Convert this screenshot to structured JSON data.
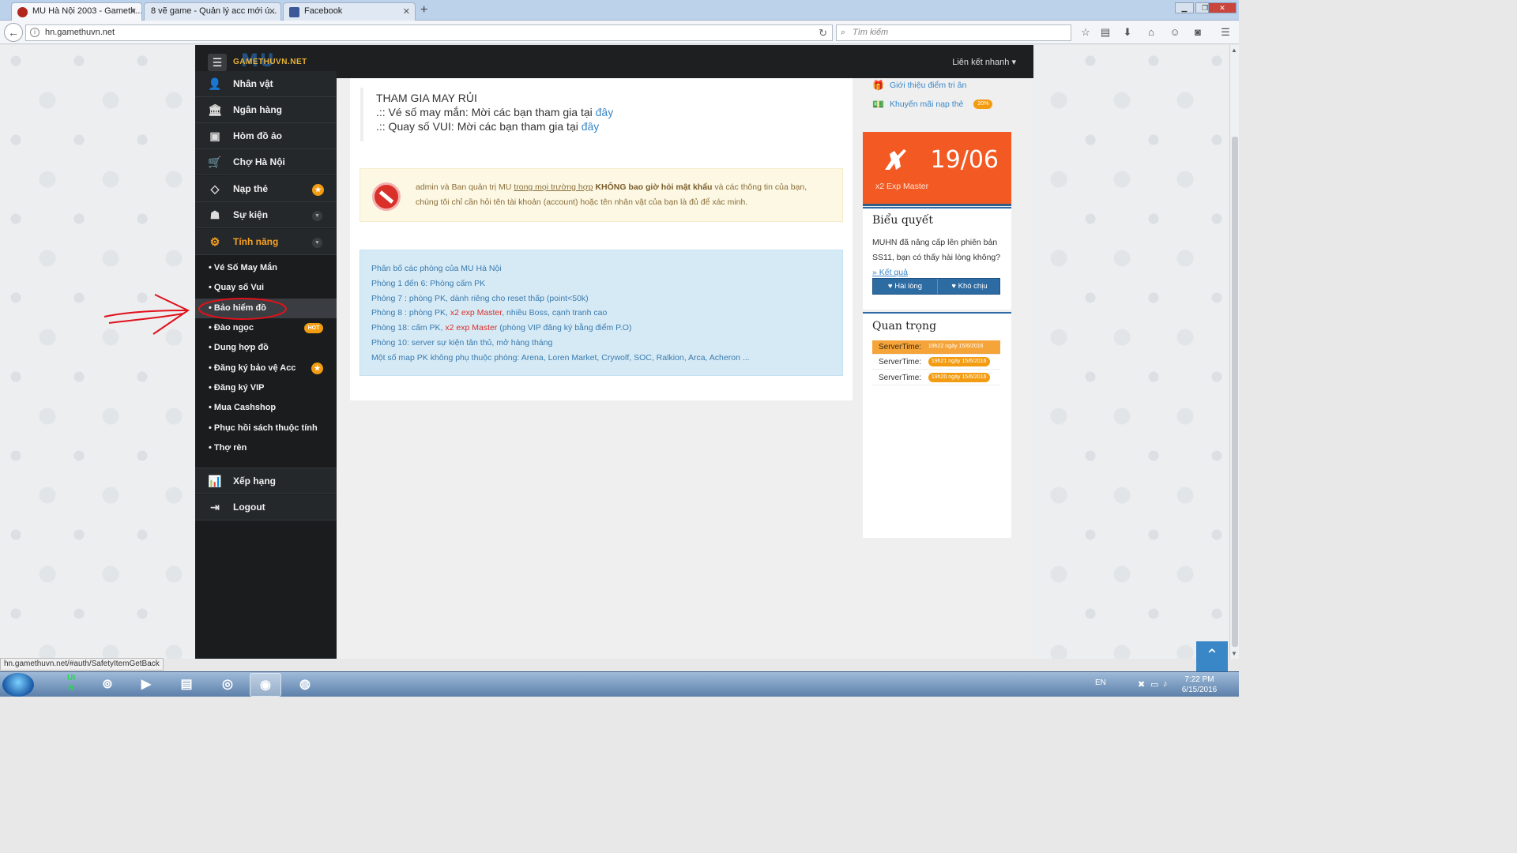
{
  "browser": {
    "tabs": [
      {
        "label": "MU Hà Nội 2003 - Gameth...",
        "active": true
      },
      {
        "label": "8 vẽ game - Quản lý acc mới ú...",
        "active": false
      },
      {
        "label": "Facebook",
        "active": false
      }
    ],
    "new_tab": "+",
    "url": "hn.gamethuvn.net",
    "search_placeholder": "Tìm kiếm",
    "status_url": "hn.gamethuvn.net/#auth/SafetyItemGetBack"
  },
  "site": {
    "logo_mu": "MU",
    "logo_text": "GAMETHUVN.NET",
    "quick_link": "Liên kết nhanh"
  },
  "sidebar": {
    "items": [
      {
        "label": "Nhân vật",
        "icon": "user-icon"
      },
      {
        "label": "Ngân hàng",
        "icon": "bank-icon"
      },
      {
        "label": "Hòm đồ ảo",
        "icon": "box-icon"
      },
      {
        "label": "Chợ Hà Nội",
        "icon": "cart-icon"
      },
      {
        "label": "Nạp thẻ",
        "icon": "diamond-icon"
      },
      {
        "label": "Sự kiện",
        "icon": "android-icon"
      },
      {
        "label": "Tính năng",
        "icon": "gears-icon"
      }
    ],
    "sub_items": [
      {
        "label": "• Vé Số May Mắn"
      },
      {
        "label": "• Quay số Vui"
      },
      {
        "label": "• Bảo hiểm đồ"
      },
      {
        "label": "• Đào ngọc",
        "badge": "HOT"
      },
      {
        "label": "• Dung hợp đồ"
      },
      {
        "label": "• Đăng ký bảo vệ Acc"
      },
      {
        "label": "• Đăng ký VIP"
      },
      {
        "label": "• Mua Cashshop"
      },
      {
        "label": "• Phục hồi sách thuộc tính"
      },
      {
        "label": "• Thợ rèn"
      }
    ],
    "bottom_items": [
      {
        "label": "Xếp hạng",
        "icon": "chart-icon"
      },
      {
        "label": "Logout",
        "icon": "logout-icon"
      }
    ]
  },
  "main": {
    "join_title": "THAM GIA MAY RỦI",
    "join_line1_prefix": ".:: Vé số may mắn: Mời các bạn tham gia tại ",
    "join_line2_prefix": ".:: Quay số VUI: Mời các bạn tham gia tại ",
    "join_link": "đây",
    "warning": {
      "part1": "admin và Ban quản trị MU ",
      "underline": "trong mọi trường hợp",
      "bold": " KHÔNG bao giờ hỏi mật khẩu",
      "part2": " và các thông tin của bạn,",
      "line2": "chúng tôi chỉ cần hỏi tên tài khoản (account) hoặc tên nhân vật của bạn là đủ để xác minh."
    },
    "info_lines": [
      "Phân bố các phòng của MU Hà Nội",
      "Phòng 1 đến 6: Phòng cấm PK",
      "Phòng 7 : phòng PK, dành riêng cho reset thấp (point<50k)",
      "Phòng 18: cấm PK, ",
      "Phòng 10: server sự kiện tân thủ, mở hàng tháng",
      "Một số map PK không phụ thuộc phòng: Arena, Loren Market, Crywolf, SOC, Ralkion, Arca, Acheron ..."
    ],
    "info_line4_prefix": "Phòng 8 : phòng PK, ",
    "info_red": "x2 exp Master",
    "info_line4_suffix": ", nhiều Boss, cạnh tranh cao",
    "info_line5_suffix": " (phòng VIP đăng ký bằng điểm P.O)"
  },
  "right": {
    "link1": "Giới thiệu điểm tri ân",
    "link2": "Khuyến mãi nạp thẻ",
    "link2_badge": "20%",
    "event_date": "19/06",
    "event_label": "x2 Exp Master",
    "poll_title": "Biểu quyết",
    "poll_question": "MUHN đã nâng cấp lên phiên bản SS11, bạn có thấy hài lòng không?",
    "poll_result": "» Kết quả",
    "poll_yes": "♥ Hài lòng",
    "poll_no": "♥ Khó chịu",
    "important_title": "Quan trọng",
    "server_label": "ServerTime:",
    "server_times": [
      "19h22 ngày 15/6/2016",
      "19h21 ngày 15/6/2016",
      "19h20 ngày 15/6/2016"
    ]
  },
  "taskbar": {
    "lang": "EN",
    "time": "7:22 PM",
    "date": "6/15/2016"
  },
  "colors": {
    "accent_orange": "#f39c12",
    "event_bg": "#f35a23",
    "sidebar_bg": "#1a1c1e",
    "link_blue": "#3a87c8"
  }
}
